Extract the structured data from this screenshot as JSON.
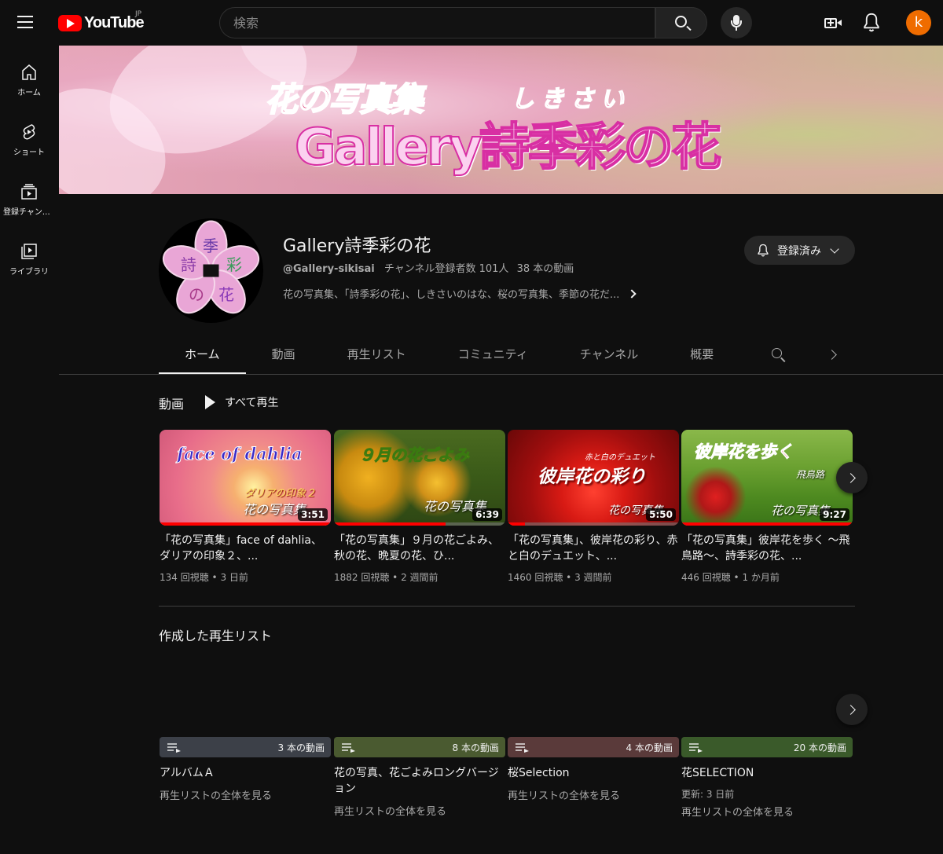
{
  "masthead": {
    "logo_text": "YouTube",
    "country_code": "JP",
    "search_placeholder": "検索",
    "avatar_letter": "k"
  },
  "guide": [
    {
      "label": "ホーム",
      "icon": "home-icon"
    },
    {
      "label": "ショート",
      "icon": "shorts-icon"
    },
    {
      "label": "登録チャンネル",
      "icon": "subscriptions-icon"
    },
    {
      "label": "ライブラリ",
      "icon": "library-icon"
    }
  ],
  "banner": {
    "title_line1": "花の写真集",
    "ruby": "しきさい",
    "title_line2": "Gallery詩季彩の花"
  },
  "channel": {
    "avatar_text": [
      "季",
      "詩",
      "彩",
      "の",
      "花"
    ],
    "name": "Gallery詩季彩の花",
    "handle": "@Gallery-sikisai",
    "subscribers": "チャンネル登録者数 101人",
    "video_count": "38 本の動画",
    "description": "花の写真集、「詩季彩の花」、しきさいのはな、桜の写真集、季節の花だ...",
    "subscribe_label": "登録済み"
  },
  "tabs": [
    "ホーム",
    "動画",
    "再生リスト",
    "コミュニティ",
    "チャンネル",
    "概要"
  ],
  "videos_section": {
    "title": "動画",
    "play_all": "すべて再生",
    "items": [
      {
        "thumb_main": "face of dahlia",
        "thumb_sub1": "ダリアの印象２",
        "thumb_sub2": "花の写真集",
        "duration": "3:51",
        "title": "「花の写真集」face of dahlia、ダリアの印象２、...",
        "views": "134 回視聴",
        "age": "3 日前",
        "progress": 1.0
      },
      {
        "thumb_main": "９月の花ごよみ",
        "thumb_sub1": "",
        "thumb_sub2": "花の写真集",
        "duration": "6:39",
        "title": "「花の写真集」９月の花ごよみ、秋の花、晩夏の花、ひ...",
        "views": "1882 回視聴",
        "age": "2 週間前",
        "progress": 0.65
      },
      {
        "thumb_main": "彼岸花の彩り",
        "thumb_sub1": "赤と白のデュエット",
        "thumb_sub2": "花の写真集",
        "duration": "5:50",
        "title": "「花の写真集」、彼岸花の彩り、赤と白のデュエット、...",
        "views": "1460 回視聴",
        "age": "3 週間前",
        "progress": 0.1
      },
      {
        "thumb_main": "彼岸花を歩く",
        "thumb_sub1": "飛鳥路",
        "thumb_sub2": "花の写真集",
        "duration": "9:27",
        "title": "「花の写真集」彼岸花を歩く ～飛鳥路～、詩季彩の花、...",
        "views": "446 回視聴",
        "age": "1 か月前",
        "progress": 1.0
      }
    ]
  },
  "playlists_section": {
    "title": "作成した再生リスト",
    "items": [
      {
        "count": "3 本の動画",
        "title": "アルバムＡ",
        "updated": "",
        "link": "再生リストの全体を見る",
        "color": "#3c4048"
      },
      {
        "count": "8 本の動画",
        "title": "花の写真、花ごよみロングバージョン",
        "updated": "",
        "link": "再生リストの全体を見る",
        "color": "#4a5a30"
      },
      {
        "count": "4 本の動画",
        "title": "桜Selection",
        "updated": "",
        "link": "再生リストの全体を見る",
        "color": "#5a3a3a"
      },
      {
        "count": "20 本の動画",
        "title": "花SELECTION",
        "updated": "更新: 3 日前",
        "link": "再生リストの全体を見る",
        "color": "#3a5a2a"
      }
    ]
  },
  "colors": {
    "background": "#0f0f0f",
    "brand_red": "#ff0000",
    "avatar_orange": "#ef6c00",
    "secondary_text": "#aaaaaa"
  }
}
